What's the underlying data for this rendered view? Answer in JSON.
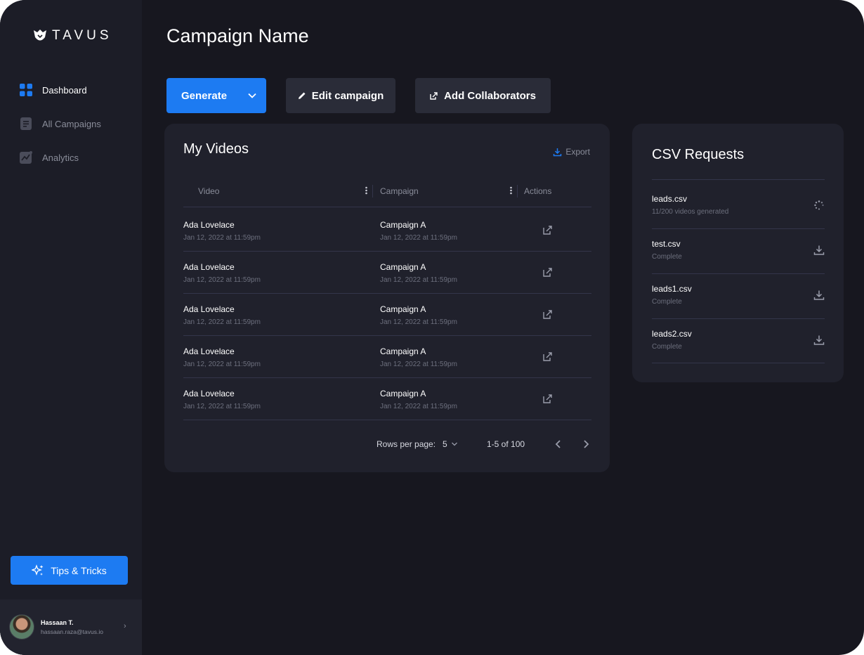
{
  "brand": {
    "name": "TAVUS"
  },
  "nav": [
    {
      "label": "Dashboard",
      "icon": "grid-icon",
      "active": true
    },
    {
      "label": "All Campaigns",
      "icon": "document-icon",
      "active": false
    },
    {
      "label": "Analytics",
      "icon": "chart-icon",
      "active": false
    }
  ],
  "tips": {
    "label": "Tips & Tricks",
    "icon": "sparkle-icon"
  },
  "user": {
    "name": "Hassaan T.",
    "email": "hassaan.raza@tavus.io"
  },
  "page": {
    "title": "Campaign Name"
  },
  "toolbar": {
    "generate_label": "Generate",
    "edit_label": "Edit campaign",
    "collab_label": "Add Collaborators"
  },
  "videos": {
    "title": "My Videos",
    "export_label": "Export",
    "columns": [
      "Video",
      "Campaign",
      "Actions"
    ],
    "rows": [
      {
        "name": "Ada Lovelace",
        "date": "Jan 12, 2022 at 11:59pm",
        "campaign": "Campaign A",
        "campaign_date": "Jan 12, 2022 at 11:59pm"
      },
      {
        "name": "Ada Lovelace",
        "date": "Jan 12, 2022 at 11:59pm",
        "campaign": "Campaign A",
        "campaign_date": "Jan 12, 2022 at 11:59pm"
      },
      {
        "name": "Ada Lovelace",
        "date": "Jan 12, 2022 at 11:59pm",
        "campaign": "Campaign A",
        "campaign_date": "Jan 12, 2022 at 11:59pm"
      },
      {
        "name": "Ada Lovelace",
        "date": "Jan 12, 2022 at 11:59pm",
        "campaign": "Campaign A",
        "campaign_date": "Jan 12, 2022 at 11:59pm"
      },
      {
        "name": "Ada Lovelace",
        "date": "Jan 12, 2022 at 11:59pm",
        "campaign": "Campaign A",
        "campaign_date": "Jan 12, 2022 at 11:59pm"
      }
    ],
    "pagination": {
      "rows_per_page_label": "Rows per page:",
      "rows_per_page_value": "5",
      "range": "1-5 of 100"
    }
  },
  "csv": {
    "title": "CSV Requests",
    "items": [
      {
        "file": "leads.csv",
        "status": "11/200 videos generated",
        "icon": "loading-spinner-icon"
      },
      {
        "file": "test.csv",
        "status": "Complete",
        "icon": "download-icon"
      },
      {
        "file": "leads1.csv",
        "status": "Complete",
        "icon": "download-icon"
      },
      {
        "file": "leads2.csv",
        "status": "Complete",
        "icon": "download-icon"
      }
    ]
  },
  "colors": {
    "accent": "#1d7bf2",
    "background": "#17171f",
    "sidebar": "#1c1d27",
    "card": "#20212c"
  }
}
